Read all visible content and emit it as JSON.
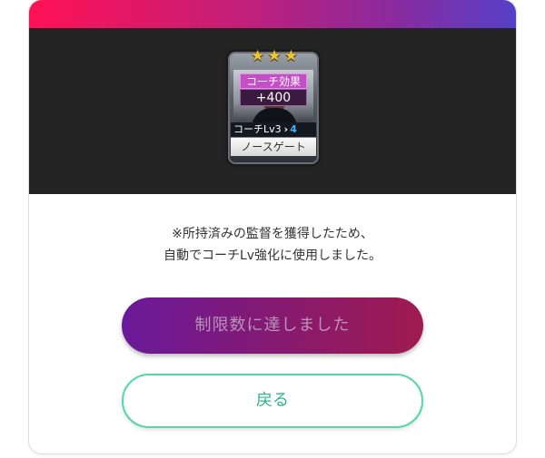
{
  "card": {
    "star_count": 3,
    "effect_label": "コーチ効果",
    "effect_value": "+400",
    "lv_current": "コーチLv3",
    "lv_arrow": "›",
    "lv_next": "4",
    "player_name": "ノースゲート"
  },
  "message": {
    "line1": "※所持済みの監督を獲得したため、",
    "line2": "自動でコーチLv強化に使用しました。"
  },
  "buttons": {
    "limit_label": "制限数に達しました",
    "back_label": "戻る"
  },
  "colors": {
    "header_gradient_start": "#ff1155",
    "header_gradient_end": "#5540c8",
    "banner_bg": "#242424",
    "limit_button_start": "#6a1a9a",
    "limit_button_end": "#a01a50",
    "back_button_accent": "#2bb584",
    "star": "#f4c430"
  },
  "icons": {
    "star": "star-icon",
    "lv_arrow": "chevron-right-icon"
  }
}
